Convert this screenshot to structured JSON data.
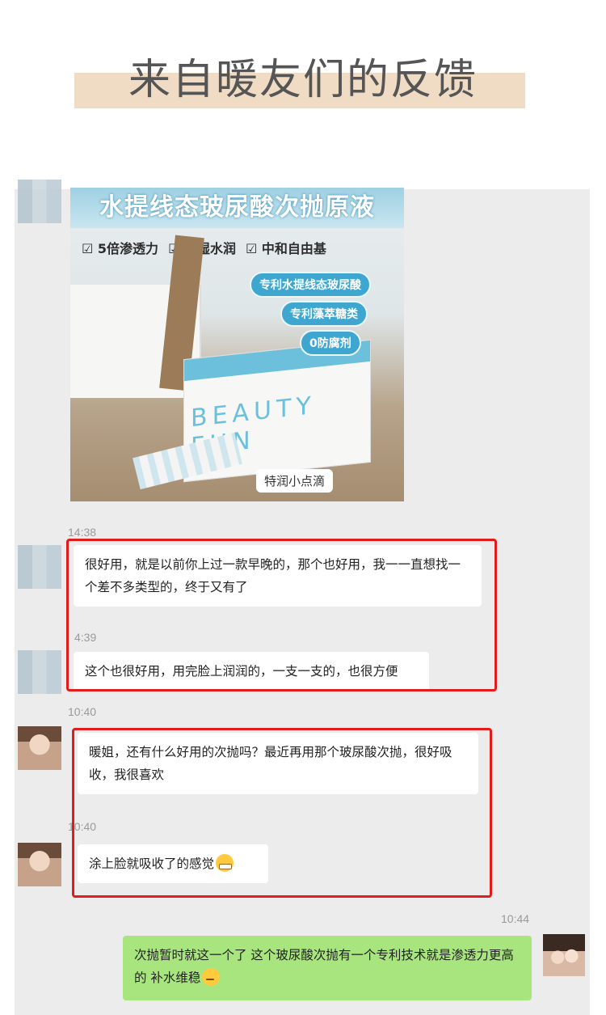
{
  "banner": {
    "title": "来自暖友们的反馈"
  },
  "product": {
    "headline": "水提线态玻尿酸次抛原液",
    "checks": [
      "☑ 5倍渗透力",
      "☑ 葆湿水润",
      "☑ 中和自由基"
    ],
    "pills": [
      "专利水提线态玻尿酸",
      "专利藻萃糖类",
      "0防腐剂"
    ],
    "brand": "BEAUTY FUN",
    "note": "特润小点滴"
  },
  "messages": [
    {
      "time": "14:38",
      "text": "很好用，就是以前你上过一款早晚的，那个也好用，我一一直想找一个差不多类型的，终于又有了"
    },
    {
      "time": "4:39",
      "text": "这个也很好用，用完脸上润润的，一支一支的，也很方便"
    },
    {
      "time": "10:40",
      "text": "暖姐，还有什么好用的次抛吗？最近再用那个玻尿酸次抛，很好吸收，我很喜欢"
    },
    {
      "time": "10:40",
      "text": "涂上脸就吸收了的感觉"
    },
    {
      "time": "10:44",
      "text": "次抛暂时就这一个了 这个玻尿酸次抛有一个专利技术就是渗透力更高的 补水维稳"
    }
  ],
  "emoji": {
    "grin": "grin-emoji",
    "think": "thinking-emoji"
  },
  "colors": {
    "highlight": "#e21b1b",
    "own_bubble": "#a9e57f",
    "chat_bg": "#ececec"
  }
}
